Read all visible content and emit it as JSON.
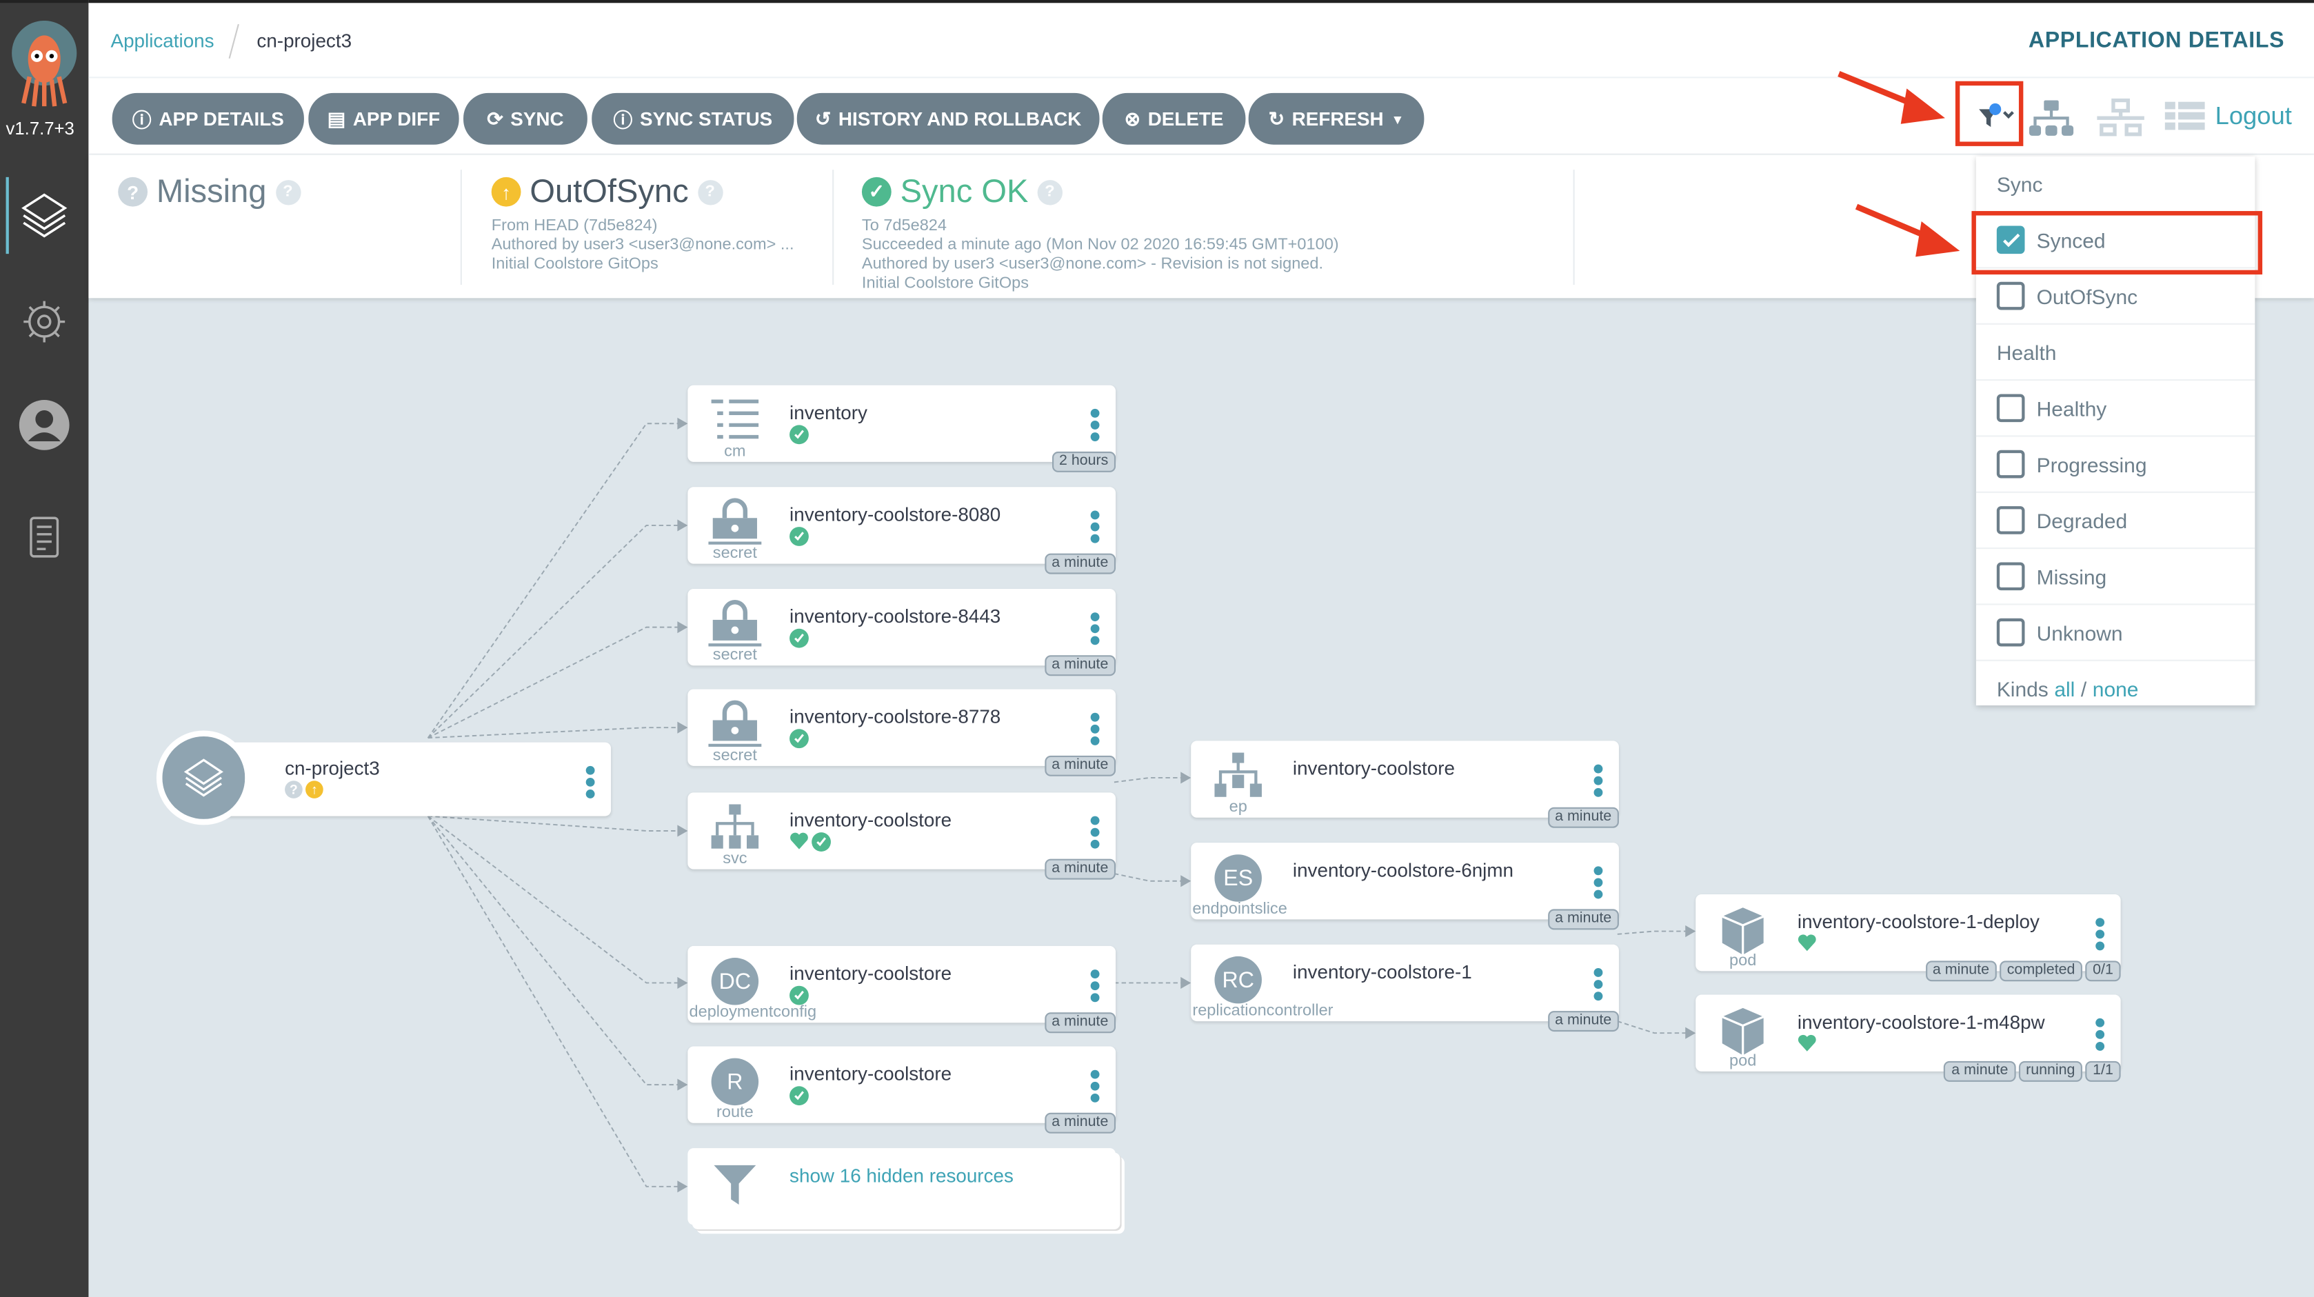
{
  "sidebar": {
    "version": "v1.7.7+3",
    "items": [
      {
        "icon": "layers-icon"
      },
      {
        "icon": "gear-icon"
      },
      {
        "icon": "user-icon"
      },
      {
        "icon": "docs-icon"
      }
    ]
  },
  "header": {
    "breadcrumb": [
      "Applications",
      "cn-project3"
    ],
    "title": "APPLICATION DETAILS"
  },
  "toolbar": {
    "buttons": [
      {
        "label": "APP DETAILS",
        "icon": "info-icon"
      },
      {
        "label": "APP DIFF",
        "icon": "file-icon"
      },
      {
        "label": "SYNC",
        "icon": "sync-icon"
      },
      {
        "label": "SYNC STATUS",
        "icon": "info-icon"
      },
      {
        "label": "HISTORY AND ROLLBACK",
        "icon": "history-icon"
      },
      {
        "label": "DELETE",
        "icon": "delete-icon"
      },
      {
        "label": "REFRESH",
        "icon": "refresh-icon"
      }
    ],
    "logout": "Logout"
  },
  "status": {
    "health": {
      "label": "Missing"
    },
    "sync": {
      "label": "OutOfSync",
      "lines": [
        "From HEAD (7d5e824)",
        "Authored by user3 <user3@none.com> ...",
        "Initial Coolstore GitOps"
      ]
    },
    "operation": {
      "label": "Sync OK",
      "lines": [
        "To 7d5e824",
        "Succeeded a minute ago (Mon Nov 02 2020 16:59:45 GMT+0100)",
        "Authored by user3 <user3@none.com> - Revision is not signed.",
        "Initial Coolstore GitOps"
      ]
    }
  },
  "filter": {
    "sync_title": "Sync",
    "sync": [
      {
        "label": "Synced",
        "checked": true
      },
      {
        "label": "OutOfSync",
        "checked": false
      }
    ],
    "health_title": "Health",
    "health": [
      {
        "label": "Healthy",
        "checked": false
      },
      {
        "label": "Progressing",
        "checked": false
      },
      {
        "label": "Degraded",
        "checked": false
      },
      {
        "label": "Missing",
        "checked": false
      },
      {
        "label": "Unknown",
        "checked": false
      }
    ],
    "kinds": "Kinds",
    "all": "all",
    "slash": "/",
    "none": "none"
  },
  "app": {
    "name": "cn-project3"
  },
  "nodes": [
    {
      "name": "inventory",
      "kind": "cm",
      "icon": "configmap-icon",
      "healthy": false,
      "synced": true,
      "tags": [
        "2 hours"
      ]
    },
    {
      "name": "inventory-coolstore-8080",
      "kind": "secret",
      "icon": "secret-icon",
      "healthy": false,
      "synced": true,
      "tags": [
        "a minute"
      ]
    },
    {
      "name": "inventory-coolstore-8443",
      "kind": "secret",
      "icon": "secret-icon",
      "healthy": false,
      "synced": true,
      "tags": [
        "a minute"
      ]
    },
    {
      "name": "inventory-coolstore-8778",
      "kind": "secret",
      "icon": "secret-icon",
      "healthy": false,
      "synced": true,
      "tags": [
        "a minute"
      ]
    },
    {
      "name": "inventory-coolstore",
      "kind": "svc",
      "icon": "service-icon",
      "healthy": true,
      "synced": true,
      "tags": [
        "a minute"
      ]
    },
    {
      "name": "inventory-coolstore",
      "kind": "deploymentconfig",
      "abbr": "DC",
      "healthy": false,
      "synced": true,
      "tags": [
        "a minute"
      ]
    },
    {
      "name": "inventory-coolstore",
      "kind": "route",
      "abbr": "R",
      "healthy": false,
      "synced": true,
      "tags": [
        "a minute"
      ]
    },
    {
      "name": "inventory-coolstore",
      "kind": "ep",
      "icon": "endpoints-icon",
      "healthy": false,
      "synced": false,
      "tags": [
        "a minute"
      ]
    },
    {
      "name": "inventory-coolstore-6njmn",
      "kind": "endpointslice",
      "abbr": "ES",
      "healthy": false,
      "synced": false,
      "tags": [
        "a minute"
      ]
    },
    {
      "name": "inventory-coolstore-1",
      "kind": "replicationcontroller",
      "abbr": "RC",
      "healthy": false,
      "synced": false,
      "tags": [
        "a minute"
      ]
    },
    {
      "name": "inventory-coolstore-1-deploy",
      "kind": "pod",
      "icon": "pod-icon",
      "healthy": true,
      "synced": false,
      "tags": [
        "a minute",
        "completed",
        "0/1"
      ]
    },
    {
      "name": "inventory-coolstore-1-m48pw",
      "kind": "pod",
      "icon": "pod-icon",
      "healthy": true,
      "synced": false,
      "tags": [
        "a minute",
        "running",
        "1/1"
      ]
    }
  ],
  "hidden": {
    "label": "show 16 hidden resources"
  },
  "colors": {
    "accent": "#3ea3b5",
    "button": "#6d7f8b",
    "synced": "#4fb98f",
    "outofsync": "#f4c030",
    "annotation": "#e8391f"
  }
}
